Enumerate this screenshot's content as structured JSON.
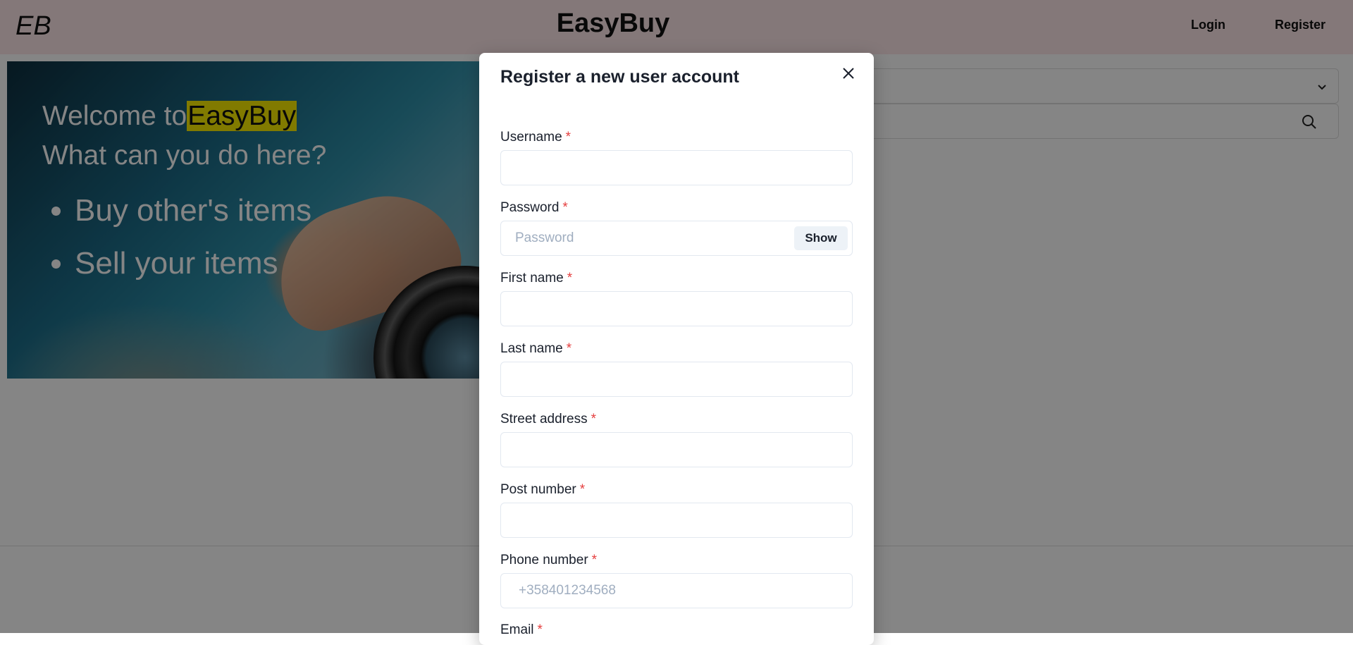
{
  "navbar": {
    "logo": "EB",
    "brand": "EasyBuy",
    "login_label": "Login",
    "register_label": "Register",
    "background_color": "#fde6e9"
  },
  "hero": {
    "welcome_prefix": "Welcome to",
    "welcome_brand": "EasyBuy",
    "question": "What can you do here?",
    "items": [
      "Buy other's items",
      "Sell your items"
    ],
    "highlight_color": "#f7ea00"
  },
  "modal": {
    "title": "Register a new user account",
    "close_icon": "close-icon",
    "required_mark": "*",
    "fields": {
      "username": {
        "label": "Username",
        "value": "",
        "placeholder": ""
      },
      "password": {
        "label": "Password",
        "value": "",
        "placeholder": "Password",
        "toggle_label": "Show"
      },
      "first_name": {
        "label": "First name",
        "value": "",
        "placeholder": ""
      },
      "last_name": {
        "label": "Last name",
        "value": "",
        "placeholder": ""
      },
      "street_address": {
        "label": "Street address",
        "value": "",
        "placeholder": ""
      },
      "post_number": {
        "label": "Post number",
        "value": "",
        "placeholder": ""
      },
      "phone_number": {
        "label": "Phone number",
        "value": "",
        "placeholder": "+358401234568"
      },
      "email": {
        "label": "Email"
      }
    },
    "required_color": "#e53e3e"
  },
  "icons": {
    "filter_dropdown": "chevron-down-icon",
    "search": "search-icon"
  }
}
